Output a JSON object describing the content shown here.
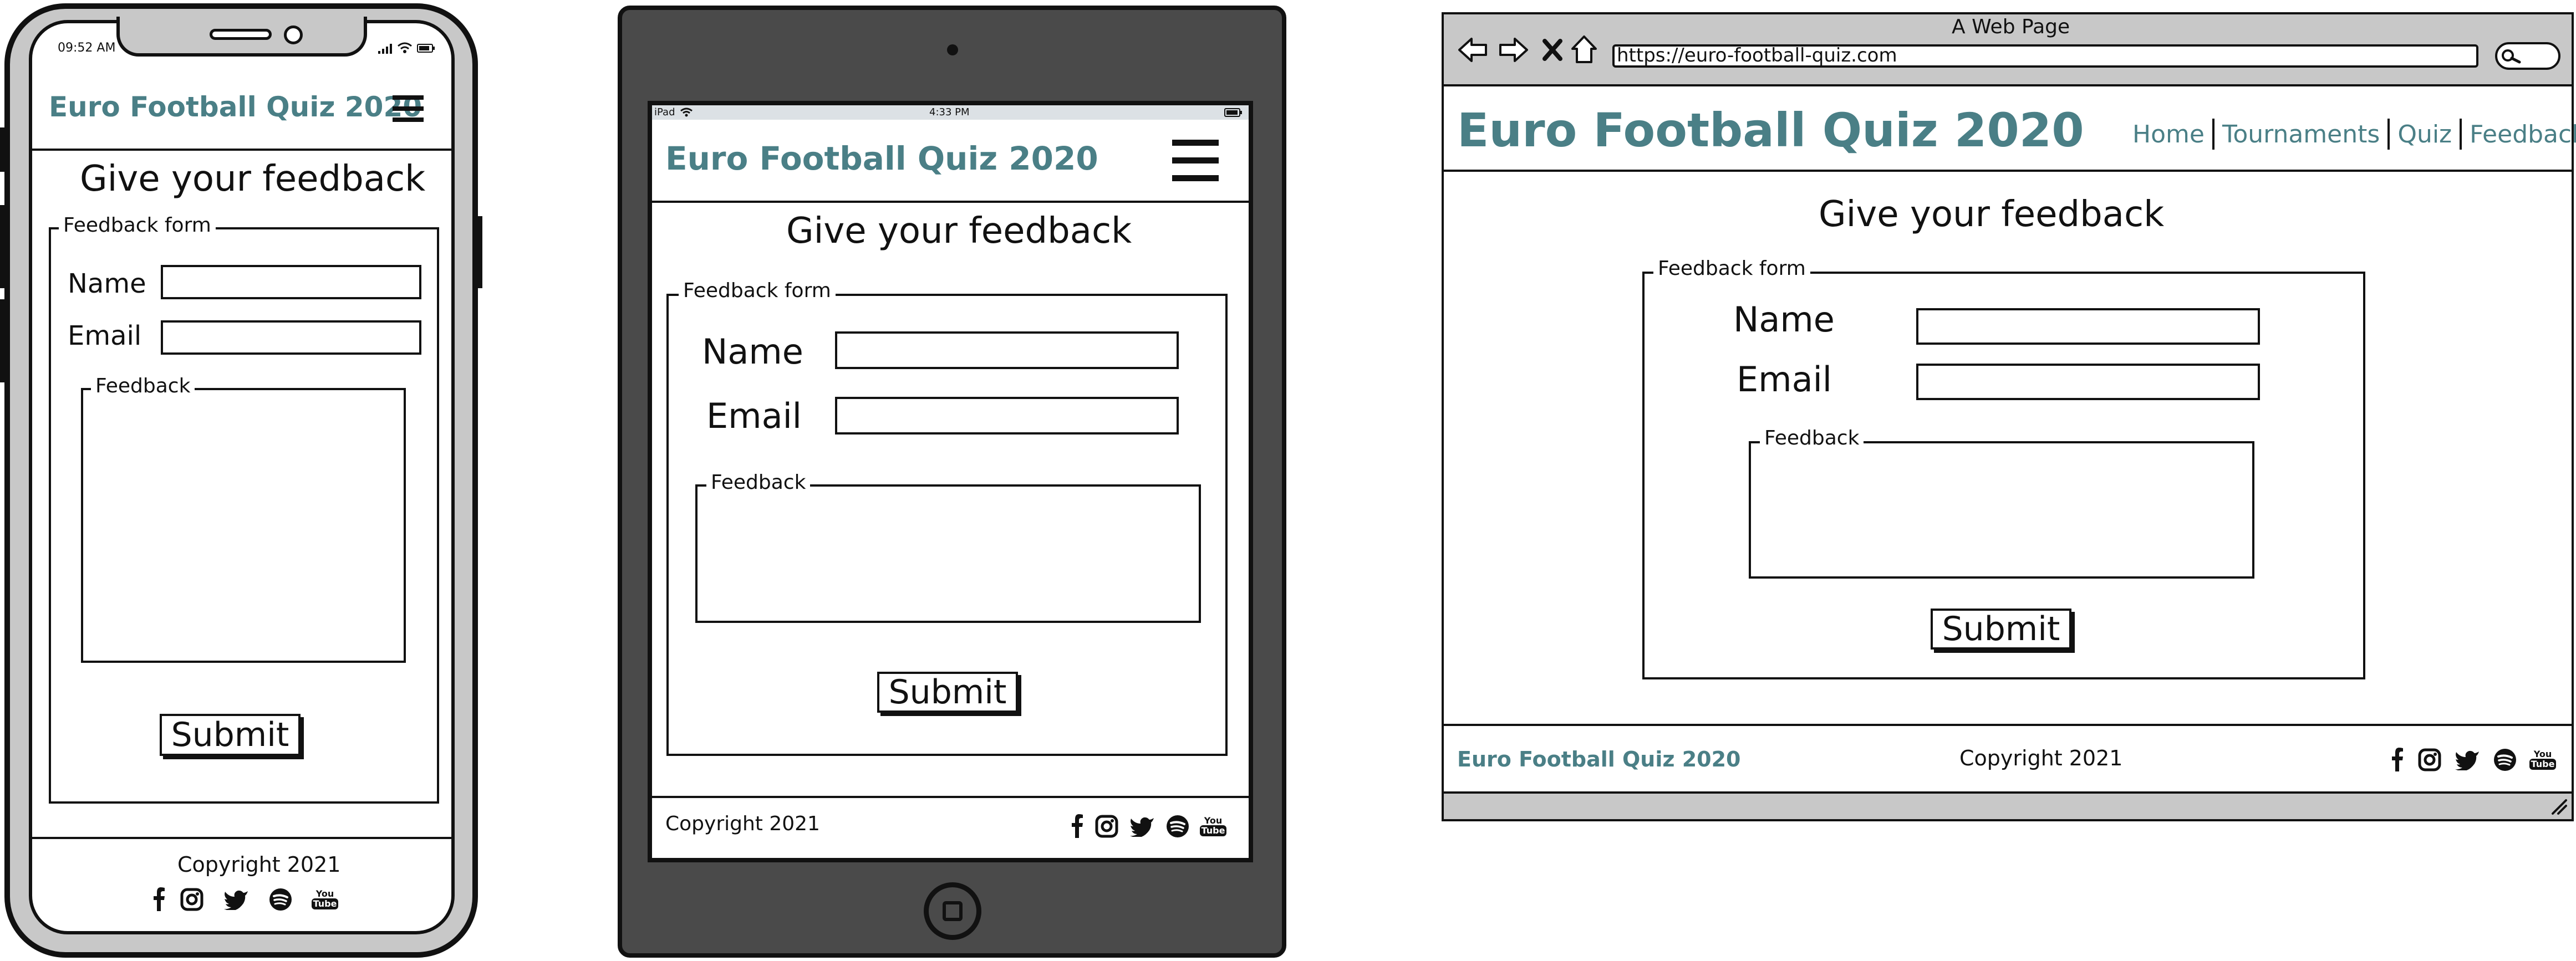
{
  "phone": {
    "status_time": "09:52 AM",
    "brand": "Euro Football Quiz 2020",
    "heading": "Give your feedback",
    "form_legend": "Feedback form",
    "name_label": "Name",
    "email_label": "Email",
    "feedback_legend": "Feedback",
    "submit_label": "Submit",
    "copyright": "Copyright 2021",
    "youtube_text": [
      "You",
      "Tube"
    ]
  },
  "tablet": {
    "status_left": "iPad",
    "status_time": "4:33 PM",
    "brand": "Euro Football Quiz 2020",
    "heading": "Give your feedback",
    "form_legend": "Feedback form",
    "name_label": "Name",
    "email_label": "Email",
    "feedback_legend": "Feedback",
    "submit_label": "Submit",
    "copyright": "Copyright 2021",
    "youtube_text": [
      "You",
      "Tube"
    ]
  },
  "desktop": {
    "window_title": "A Web Page",
    "url": "https://euro-football-quiz.com",
    "brand": "Euro Football Quiz 2020",
    "nav": [
      "Home",
      "Tournaments",
      "Quiz",
      "Feedback"
    ],
    "heading": "Give your feedback",
    "form_legend": "Feedback form",
    "name_label": "Name",
    "email_label": "Email",
    "feedback_legend": "Feedback",
    "submit_label": "Submit",
    "footer_brand": "Euro Football Quiz 2020",
    "copyright": "Copyright 2021",
    "youtube_text": [
      "You",
      "Tube"
    ]
  },
  "colors": {
    "brand": "#4a7f86",
    "device_gray": "#c8c8c8",
    "tablet_frame": "#4a4a4a",
    "ink": "#111111"
  }
}
